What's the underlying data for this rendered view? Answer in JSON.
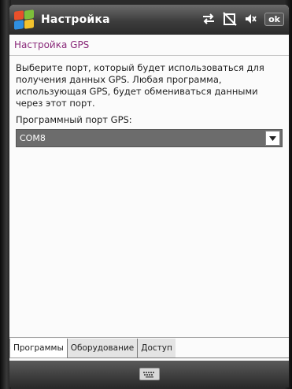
{
  "titlebar": {
    "title": "Настройка",
    "ok_label": "ok",
    "icons": [
      "windows-start-icon",
      "connectivity-arrows-icon",
      "no-signal-icon",
      "volume-icon"
    ]
  },
  "header": {
    "title": "Настройка GPS"
  },
  "content": {
    "description": "Выберите порт, который будет использоваться для получения данных GPS. Любая программа, использующая GPS, будет обмениваться данными через этот порт.",
    "port_label": "Программный порт GPS:",
    "port_value": "COM8"
  },
  "tabs": [
    {
      "label": "Программы",
      "active": true
    },
    {
      "label": "Оборудование",
      "active": false
    },
    {
      "label": "Доступ",
      "active": false
    }
  ],
  "menubar": {
    "icon": "keyboard-icon"
  },
  "colors": {
    "header_text": "#8a2a7a",
    "dropdown_bg": "#6c6c6c",
    "titlebar": "#3d3d3d"
  }
}
